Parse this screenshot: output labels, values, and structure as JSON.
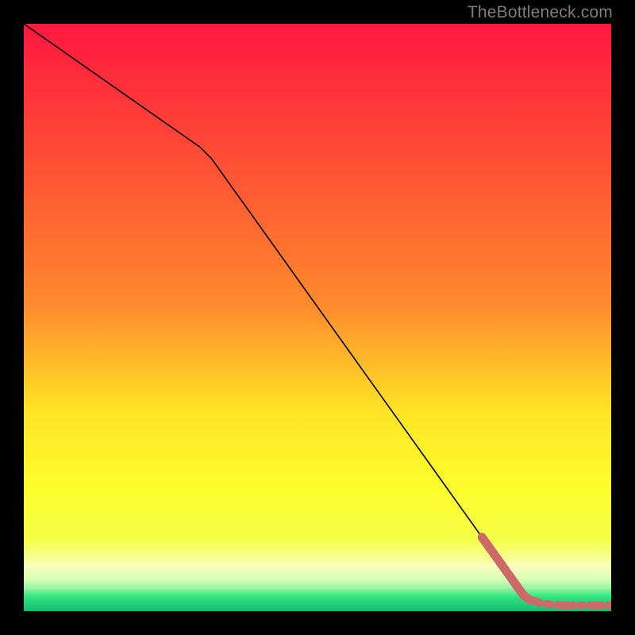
{
  "attribution": "TheBottleneck.com",
  "chart_data": {
    "type": "line",
    "title": "",
    "xlabel": "",
    "ylabel": "",
    "xlim": [
      0,
      100
    ],
    "ylim": [
      0,
      100
    ],
    "grid": false,
    "legend": false,
    "background_gradient": {
      "top": "#ff173f",
      "upper_mid": "#ff8b2d",
      "mid": "#ffe424",
      "lower_mid": "#f6ff4a",
      "pale": "#f8ffbf",
      "green": "#2fe681",
      "bottom_green": "#17b96f"
    },
    "series": [
      {
        "name": "bottleneck-curve",
        "color": "#000000",
        "style": "solid",
        "x": [
          0,
          5,
          10,
          15,
          20,
          25,
          30,
          32,
          35,
          40,
          45,
          50,
          55,
          60,
          65,
          70,
          75,
          80,
          82,
          84,
          85,
          86,
          88,
          90,
          92,
          94,
          96,
          98,
          100
        ],
        "y": [
          100,
          96.5,
          93,
          89.5,
          86,
          82.5,
          79,
          77,
          72.8,
          65.8,
          58.8,
          51.8,
          44.8,
          37.8,
          30.8,
          23.8,
          16.8,
          9.8,
          7,
          4.2,
          2.8,
          2.0,
          1.4,
          1.1,
          1.0,
          1.0,
          1.0,
          1.0,
          1.0
        ]
      },
      {
        "name": "highlight-tail",
        "color": "#cc6969",
        "style": "thick-dashed",
        "x": [
          78,
          80,
          82,
          84,
          85,
          86,
          87,
          88,
          89,
          90,
          91,
          92,
          93,
          94,
          95,
          96,
          97,
          98,
          99,
          100
        ],
        "y": [
          12.6,
          9.8,
          7.0,
          4.2,
          2.8,
          2.0,
          1.7,
          1.4,
          1.25,
          1.1,
          1.05,
          1.0,
          1.0,
          1.0,
          1.0,
          1.0,
          1.0,
          1.0,
          1.0,
          1.0
        ]
      }
    ],
    "end_marker": {
      "x": 100,
      "y": 1.0,
      "color": "#cc6969",
      "r": 5
    }
  }
}
